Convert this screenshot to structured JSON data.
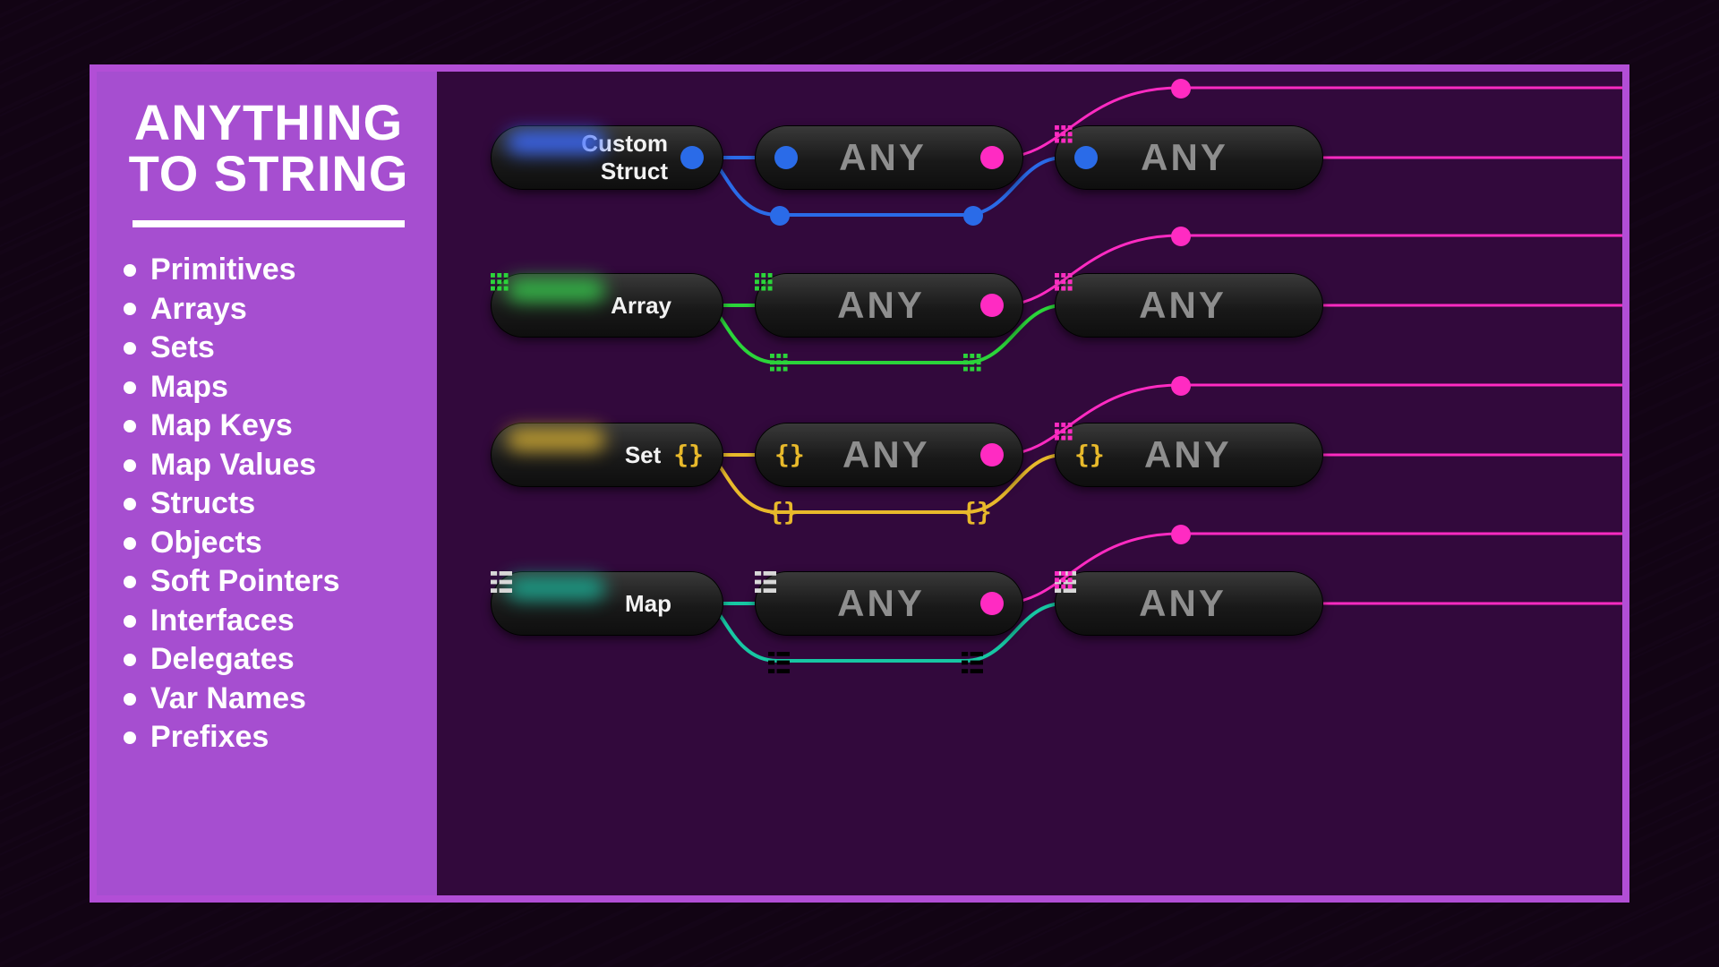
{
  "title_line1": "ANYTHING",
  "title_line2": "TO STRING",
  "features": [
    "Primitives",
    "Arrays",
    "Sets",
    "Maps",
    "Map Keys",
    "Map Values",
    "Structs",
    "Objects",
    "Soft Pointers",
    "Interfaces",
    "Delegates",
    "Var Names",
    "Prefixes"
  ],
  "any_label": "ANY",
  "rows": [
    {
      "name": "Custom Struct",
      "kind": "struct",
      "color": "#2a6be8",
      "glow": "#3d6bff"
    },
    {
      "name": "Array",
      "kind": "array",
      "color": "#2bd43a",
      "glow": "#35c24a"
    },
    {
      "name": "Set",
      "kind": "set",
      "color": "#e8b92b",
      "glow": "#c9a531"
    },
    {
      "name": "Map",
      "kind": "map",
      "color": "#17c7a3",
      "glow": "#1aa890"
    }
  ],
  "colors": {
    "accent": "#a64ed0",
    "frame": "#b24ed6",
    "canvas": "#32093c",
    "exec": "#ff2bc2",
    "node_text": "#8e8e8e"
  }
}
